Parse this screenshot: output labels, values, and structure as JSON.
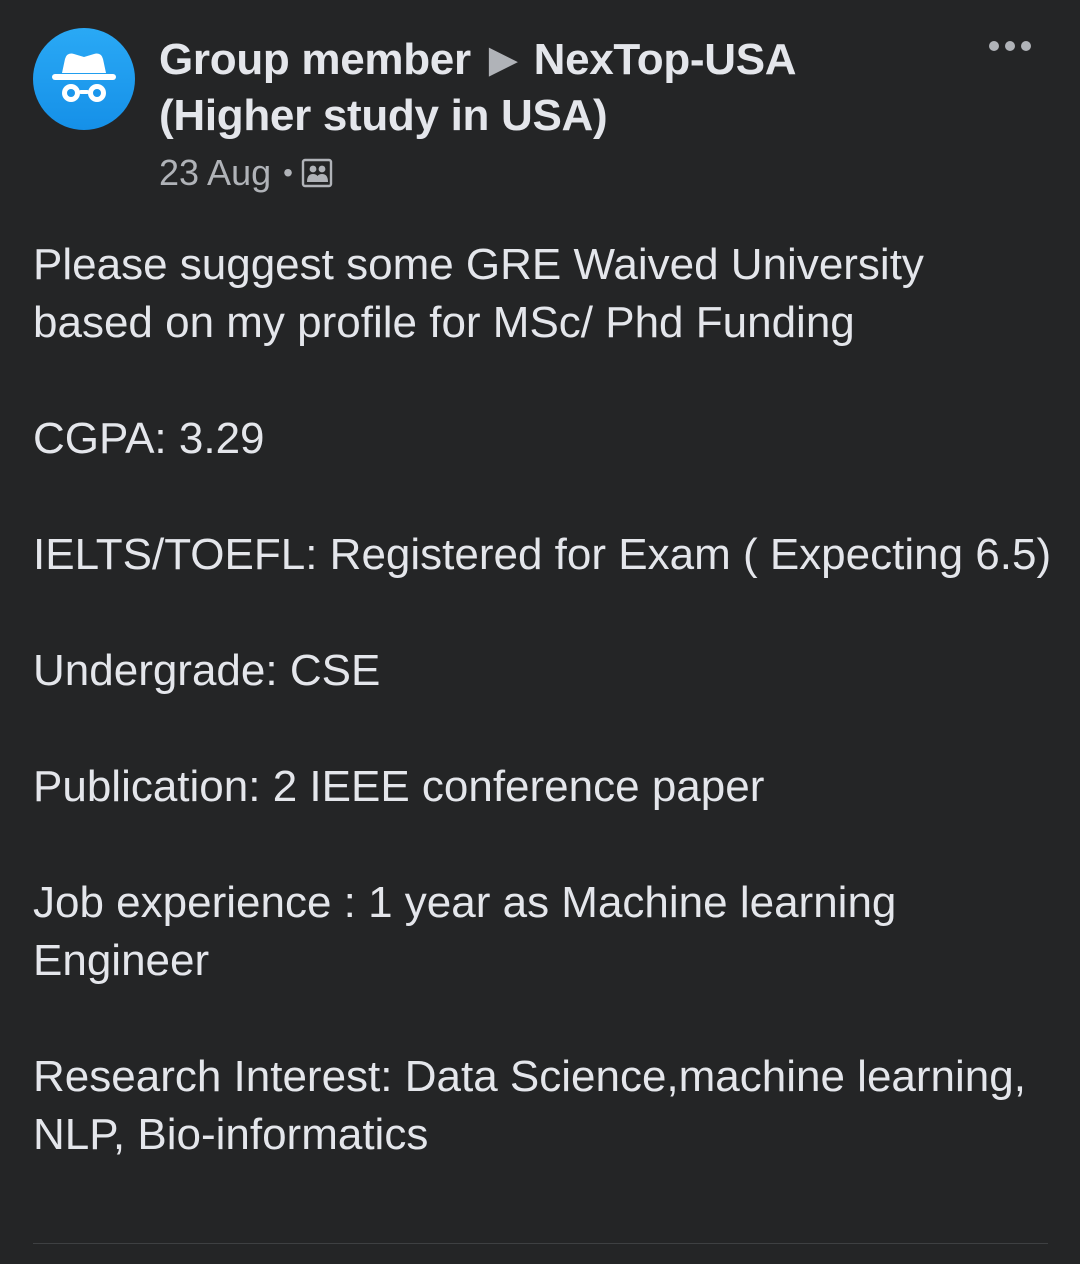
{
  "post": {
    "author": "Group member",
    "separator": "▶",
    "group_name": "NexTop-USA (Higher study in USA)",
    "date": "23 Aug",
    "dot": "•",
    "privacy_icon": "members-group-icon",
    "avatar_icon": "anonymous-incognito-icon",
    "more_icon": "ellipsis-icon",
    "paragraphs": [
      "Please suggest some GRE Waived University based on my profile for MSc/ Phd Funding",
      "CGPA: 3.29",
      "IELTS/TOEFL: Registered for Exam ( Expecting 6.5)",
      "Undergrade: CSE",
      "Publication: 2 IEEE conference paper",
      "Job experience : 1 year as Machine learning Engineer",
      "Research Interest: Data Science,machine learning, NLP, Bio-informatics"
    ]
  },
  "colors": {
    "background": "#242526",
    "primary_text": "#e4e6eb",
    "secondary_text": "#b0b3b8",
    "avatar_blue": "#1da1f2"
  }
}
